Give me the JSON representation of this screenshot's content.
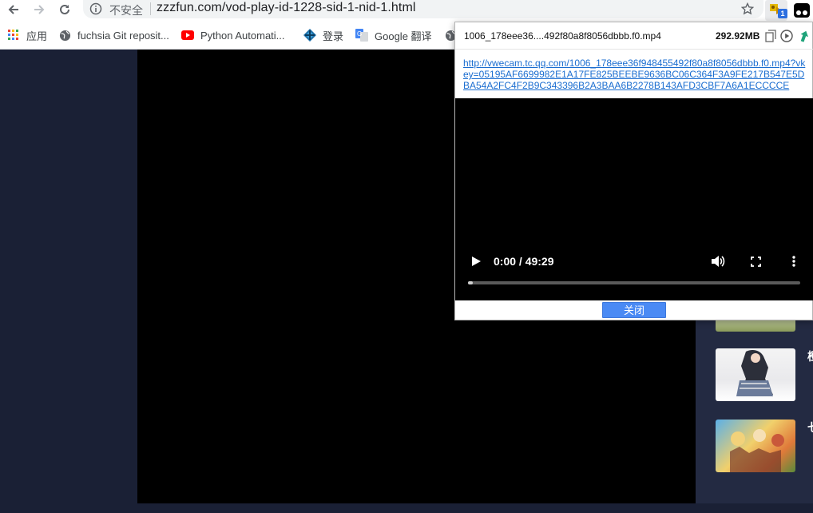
{
  "browser": {
    "security_label": "不安全",
    "url": "zzzfun.com/vod-play-id-1228-sid-1-nid-1.html",
    "extension_badge": "1"
  },
  "bookmarks": [
    {
      "label": "应用",
      "icon": "apps-grid-icon"
    },
    {
      "label": "fuchsia Git reposit...",
      "icon": "globe-icon"
    },
    {
      "label": "Python Automati...",
      "icon": "youtube-icon"
    },
    {
      "label": "登录",
      "icon": "diamond-logo-icon"
    },
    {
      "label": "Google 翻译",
      "icon": "translate-icon"
    },
    {
      "label": "",
      "icon": "globe-icon"
    }
  ],
  "popup": {
    "filename": "1006_178eee36....492f80a8f8056dbbb.f0.mp4",
    "size": "292.92MB",
    "link": "http://vwecam.tc.qq.com/1006_178eee36f948455492f80a8f8056dbbb.f0.mp4?vkey=05195AF6699982E1A17FE825BEEBE9636BC06C364F3A9FE217B547E5DBA54A2FC4F2B9C343396B2A3BAA6B2278B143AFD3CBF7A6A1ECCCCE",
    "video_time": "0:00 / 49:29",
    "video_progress": 0.01,
    "close_label": "关闭"
  },
  "sidebar": {
    "texts": [
      "橙",
      "七"
    ]
  },
  "colors": {
    "page_bg": "#1a2035",
    "panel_bg": "#232a42",
    "accent": "#4a8af4",
    "link": "#1a6dd0"
  }
}
